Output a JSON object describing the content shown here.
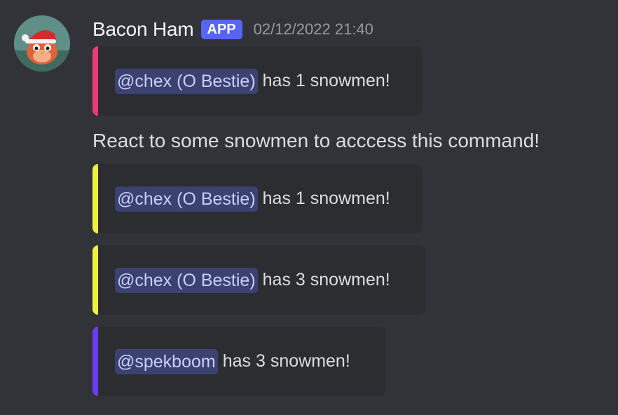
{
  "message": {
    "avatar_icon": "santa-hat-bird-avatar",
    "username": "Bacon Ham",
    "badge": "APP",
    "timestamp": "02/12/2022 21:40",
    "content": "React to some snowmen to acccess this command!"
  },
  "embeds": [
    {
      "color": "#ec3a78",
      "mention": "@chex (O Bestie)",
      "text": "has 1 snowmen!"
    },
    {
      "color": "#eef23c",
      "mention": "@chex (O Bestie)",
      "text": "has 1 snowmen!"
    },
    {
      "color": "#eef23c",
      "mention": "@chex (O Bestie)",
      "text": "has 3 snowmen!"
    },
    {
      "color": "#6a3cf2",
      "mention": "@spekboom",
      "text": "has 3 snowmen!"
    }
  ],
  "colors": {
    "background": "#313338",
    "embed_background": "#2b2d31",
    "badge": "#5865f2",
    "mention_background": "#3c4270",
    "mention_text": "#c9cdfb"
  }
}
